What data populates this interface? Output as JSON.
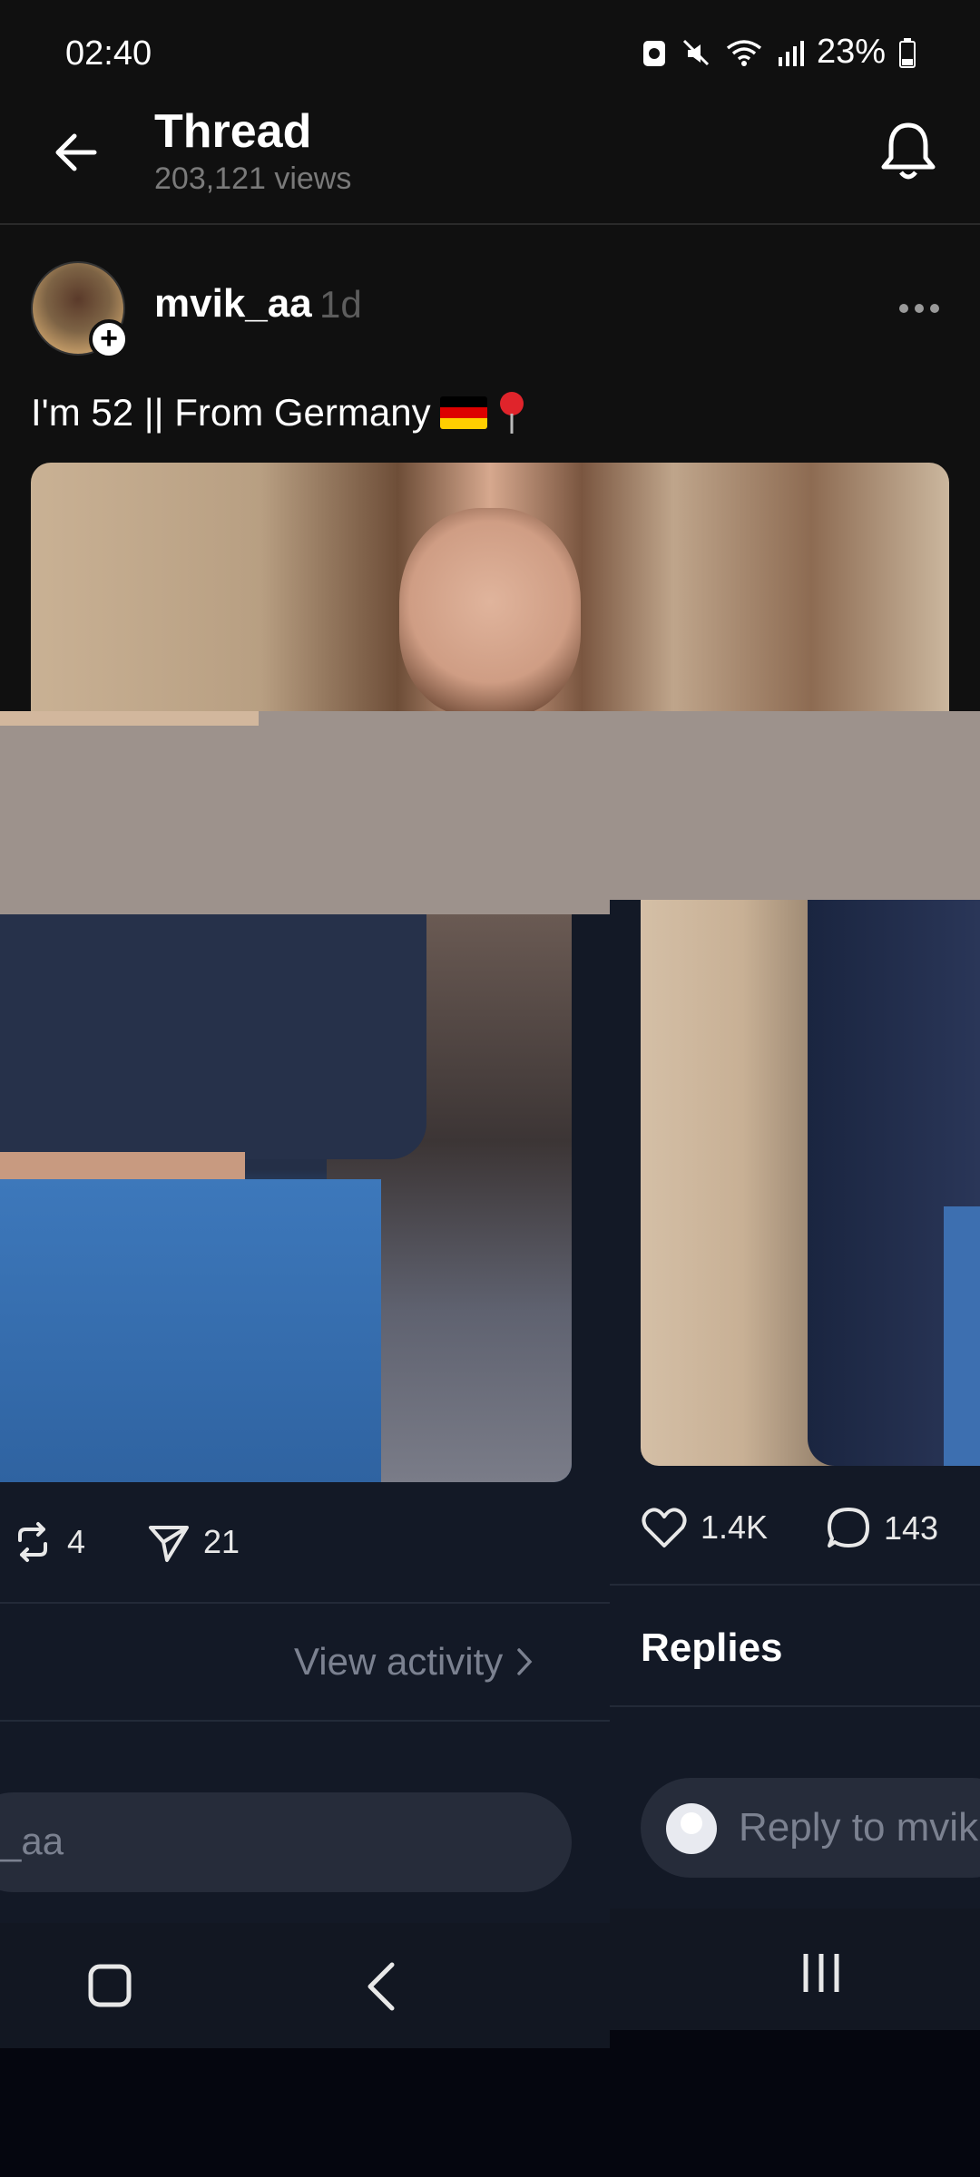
{
  "status_bar": {
    "time": "02:40",
    "battery": "23%"
  },
  "header": {
    "title": "Thread",
    "views": "203,121 views"
  },
  "post": {
    "username": "mvik_aa",
    "time_ago": "1d",
    "text": "I'm 52 || From Germany"
  },
  "actions": {
    "reposts": "4",
    "shares": "21",
    "likes": "1.4K",
    "comments": "143"
  },
  "view_activity_label": "View activity",
  "replies_heading": "Replies",
  "reply_input": {
    "left_fragment": "_aa",
    "placeholder": "Reply to mvik"
  },
  "icons": [
    "back-arrow-icon",
    "bell-icon",
    "more-icon",
    "flag-germany-icon",
    "pin-icon",
    "repost-icon",
    "share-icon",
    "heart-icon",
    "comment-icon",
    "chevron-right-icon",
    "home-icon",
    "nav-back-icon",
    "recents-icon"
  ]
}
